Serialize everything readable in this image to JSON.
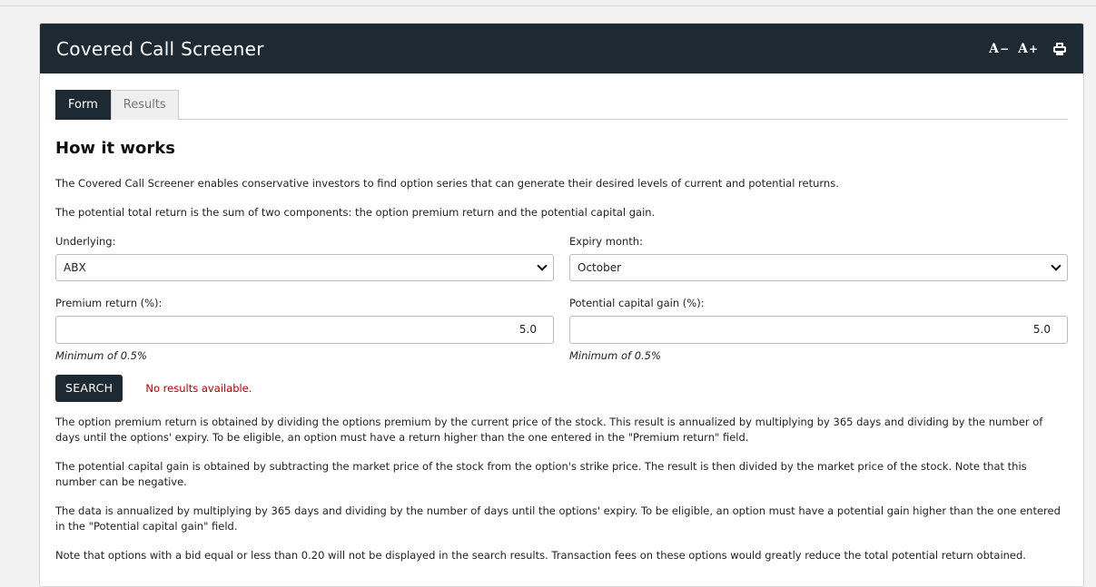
{
  "panel": {
    "title": "Covered Call Screener",
    "tools": {
      "decrease_label": "A",
      "increase_label": "A"
    }
  },
  "tabs": [
    {
      "label": "Form",
      "active": true
    },
    {
      "label": "Results",
      "active": false
    }
  ],
  "section_title": "How it works",
  "intro": [
    "The Covered Call Screener enables conservative investors to find option series that can generate their desired levels of current and potential returns.",
    "The potential total return is the sum of two components: the option premium return and the potential capital gain."
  ],
  "form": {
    "underlying": {
      "label": "Underlying:",
      "value": "ABX"
    },
    "expiry": {
      "label": "Expiry month:",
      "value": "October"
    },
    "premium": {
      "label": "Premium return (%):",
      "value": "5.0",
      "hint": "Minimum of 0.5%"
    },
    "capital_gain": {
      "label": "Potential capital gain (%):",
      "value": "5.0",
      "hint": "Minimum of 0.5%"
    },
    "search_label": "SEARCH",
    "status": "No results available."
  },
  "explanations": [
    "The option premium return is obtained by dividing the options premium by the current price of the stock. This result is annualized by multiplying by 365 days and dividing by the number of days until the options' expiry. To be eligible, an option must have a return higher than the one entered in the \"Premium return\" field.",
    "The potential capital gain is obtained by subtracting the market price of the stock from the option's strike price. The result is then divided by the market price of the stock. Note that this number can be negative.",
    "The data is annualized by multiplying by 365 days and dividing by the number of days until the options' expiry. To be eligible, an option must have a potential gain higher than the one entered in the \"Potential capital gain\" field.",
    "Note that options with a bid equal or less than 0.20 will not be displayed in the search results. Transaction fees on these options would greatly reduce the total potential return obtained."
  ]
}
